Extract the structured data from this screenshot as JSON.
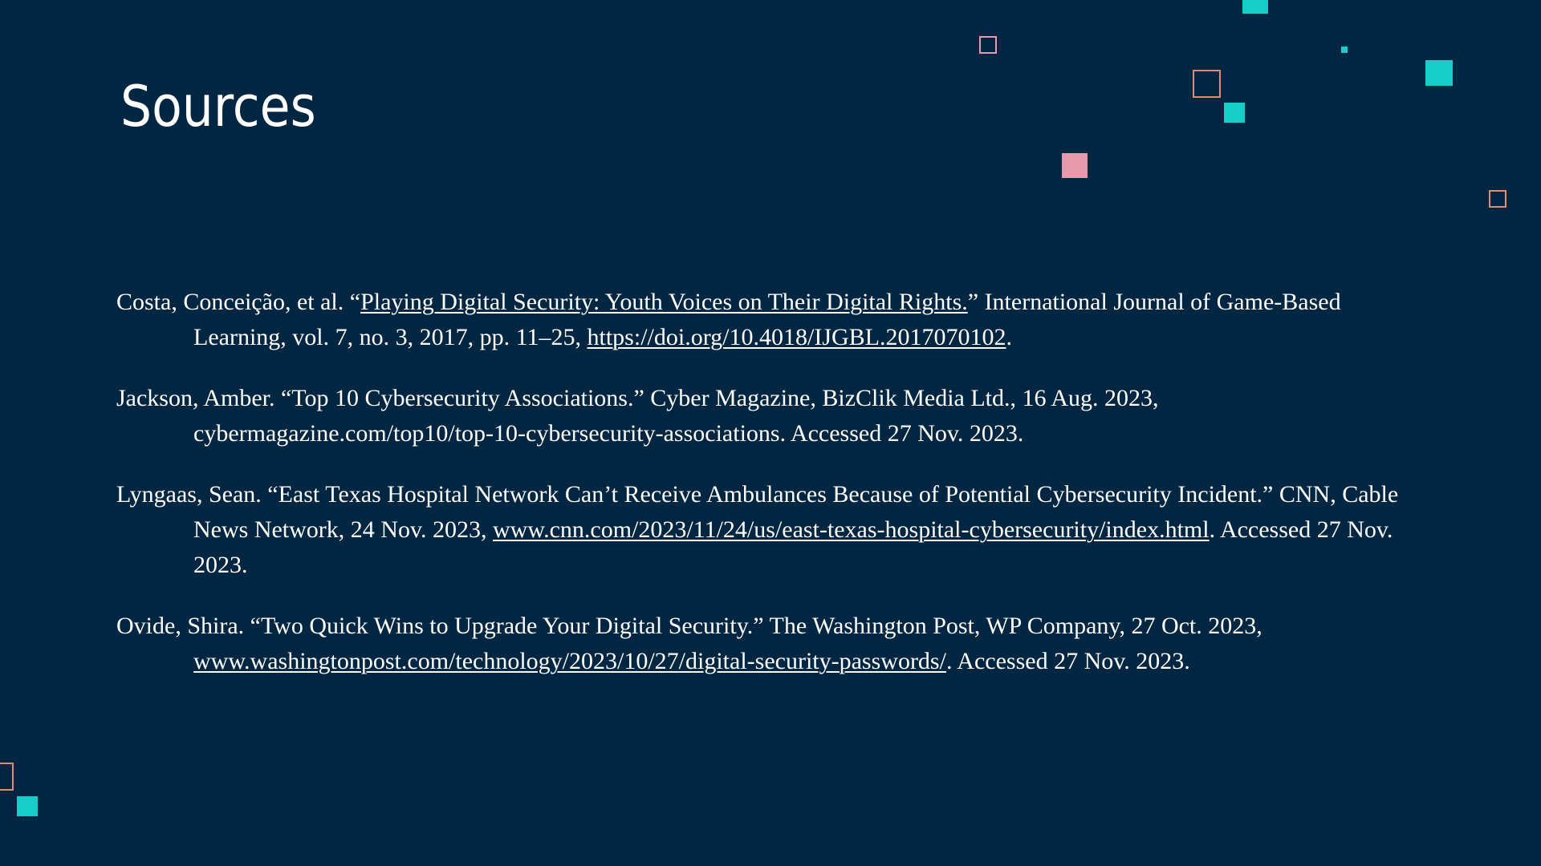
{
  "slide": {
    "title": "Sources"
  },
  "references": [
    {
      "before": "Costa, Conceição, et al. “",
      "title_link": "Playing Digital Security: Youth Voices on Their Digital Rights.",
      "middle": "” International Journal of Game-Based Learning, vol. 7, no. 3, 2017, pp. 11–25, ",
      "url_link": "https://doi.org/10.4018/IJGBL.2017070102",
      "after": "."
    },
    {
      "text": "Jackson, Amber. “Top 10 Cybersecurity Associations.” Cyber Magazine, BizClik Media Ltd., 16 Aug. 2023, cybermagazine.com/top10/top-10-cybersecurity-associations. Accessed 27 Nov. 2023."
    },
    {
      "before": "Lyngaas, Sean. “East Texas Hospital Network Can’t Receive Ambulances Because of Potential Cybersecurity Incident.” CNN, Cable News Network, 24 Nov. 2023, ",
      "url_link": "www.cnn.com/2023/11/24/us/east-texas-hospital-cybersecurity/index.html",
      "after": ". Accessed 27 Nov. 2023."
    },
    {
      "before": "Ovide, Shira. “Two Quick Wins to Upgrade Your Digital Security.” The Washington Post, WP Company, 27 Oct. 2023, ",
      "url_link": "www.washingtonpost.com/technology/2023/10/27/digital-security-passwords/",
      "after": ". Accessed 27 Nov. 2023."
    }
  ],
  "colors": {
    "background": "#012642",
    "text": "#ffffff",
    "accent_teal": "#16cdc9",
    "accent_pink": "#e79aad",
    "accent_orange": "#e38c74"
  }
}
